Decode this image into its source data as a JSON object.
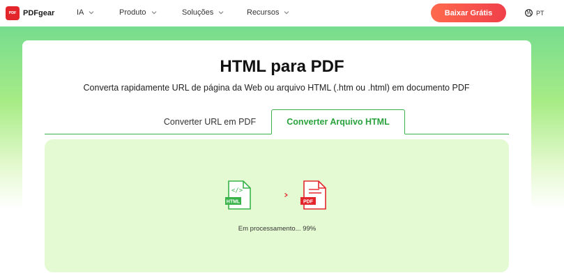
{
  "header": {
    "brand": {
      "name": "PDFgear",
      "logo_text": "PDF"
    },
    "nav": [
      {
        "label": "IA"
      },
      {
        "label": "Produto"
      },
      {
        "label": "Soluções"
      },
      {
        "label": "Recursos"
      }
    ],
    "cta_label": "Baixar Grátis",
    "language": "PT"
  },
  "page": {
    "title": "HTML para PDF",
    "subtitle": "Converta rapidamente URL de página da Web ou arquivo HTML (.htm ou .html) em documento PDF"
  },
  "tabs": [
    {
      "label": "Converter URL em PDF",
      "active": false
    },
    {
      "label": "Converter Arquivo HTML",
      "active": true
    }
  ],
  "process": {
    "source_badge": "HTML",
    "source_glyph": "</>",
    "target_badge": "PDF",
    "status_label": "Em processamento",
    "status_ellipsis": "...",
    "progress_text": "99%",
    "progress": 0.99
  },
  "colors": {
    "brand_red": "#e3262c",
    "accent_green": "#37b34a",
    "panel_bg": "#e4fad2",
    "cta_start": "#ff6a4d",
    "cta_end": "#f0404a"
  },
  "icons": [
    "chevron-down-icon",
    "globe-icon",
    "html-file-icon",
    "pdf-file-icon",
    "arrow-right-icon"
  ]
}
